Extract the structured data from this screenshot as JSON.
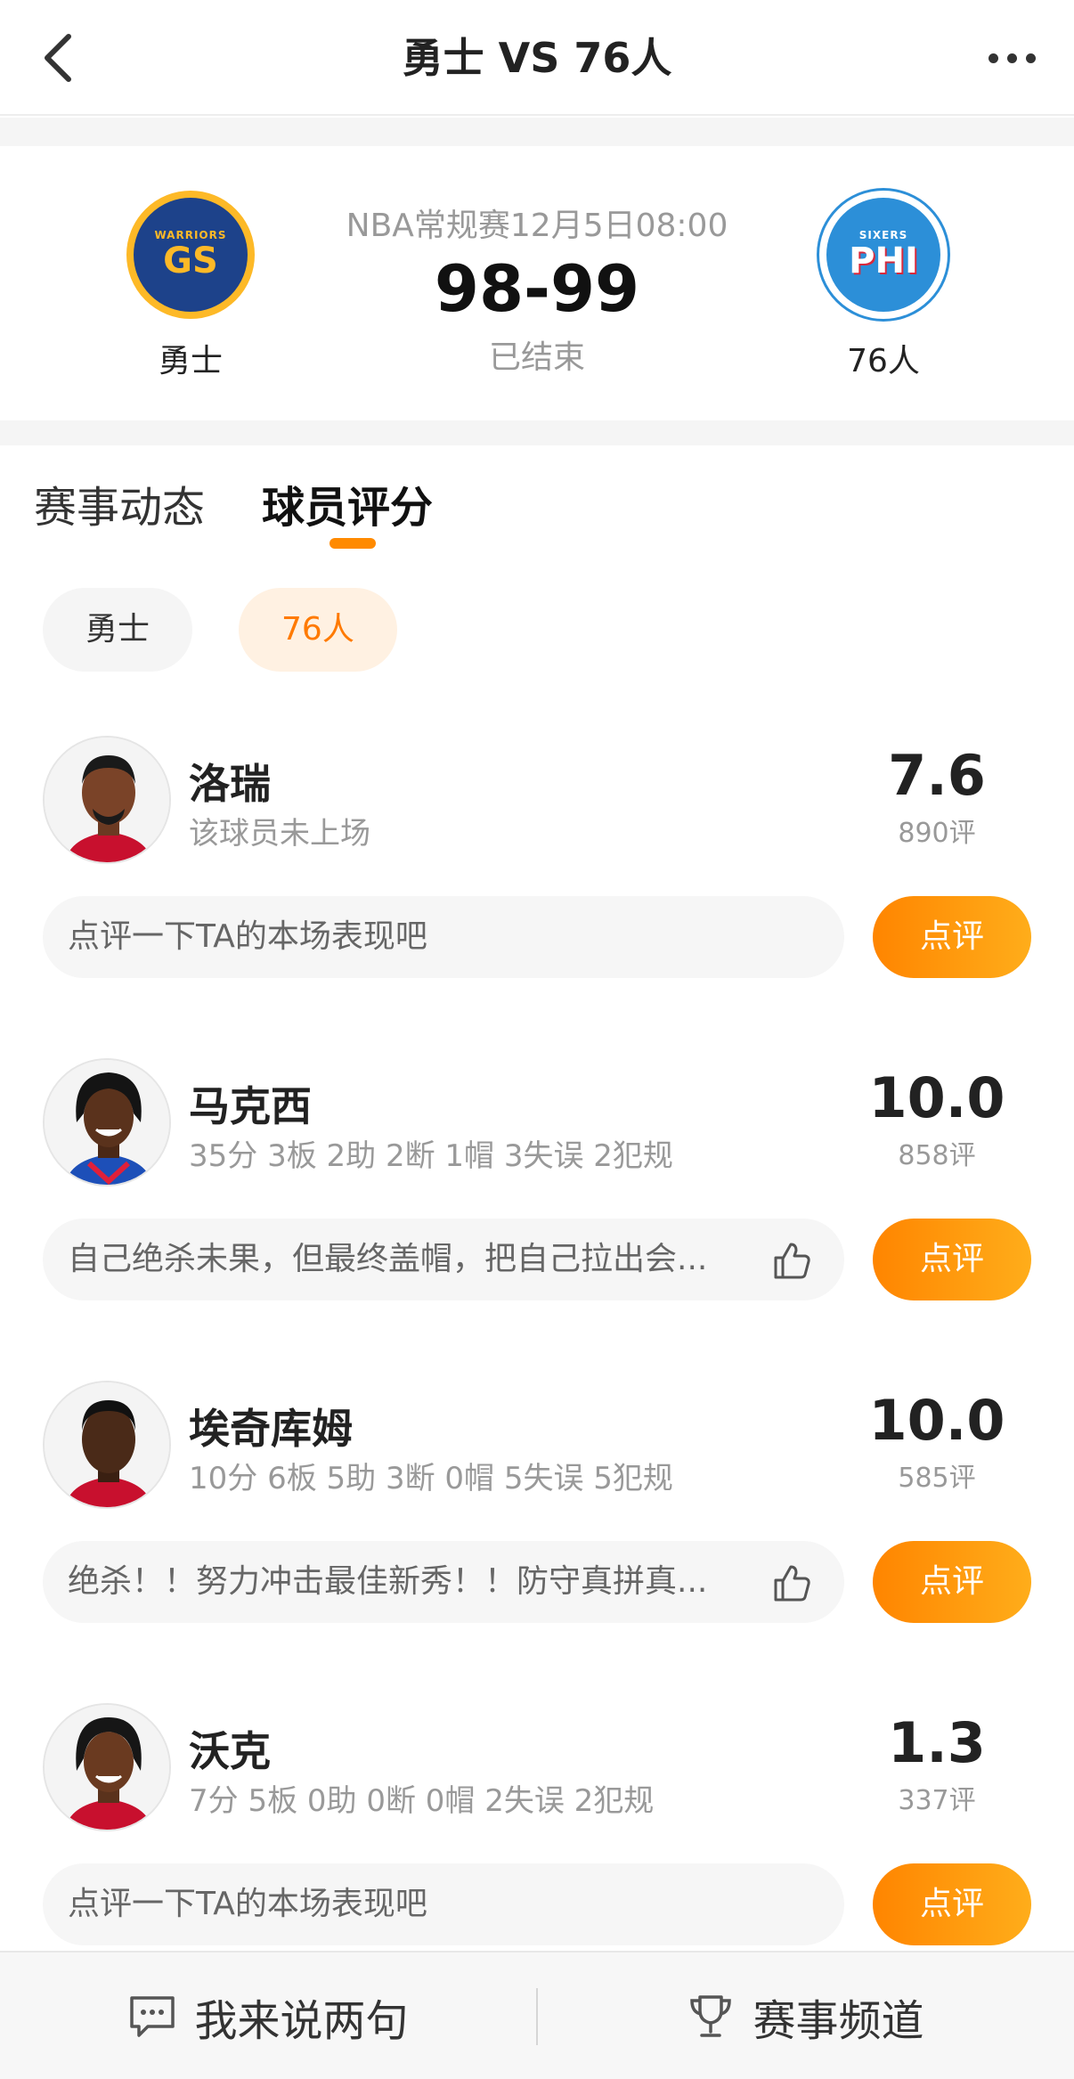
{
  "nav": {
    "title": "勇士 VS 76人"
  },
  "match": {
    "info": "NBA常规赛12月5日08:00",
    "score": "98-99",
    "status": "已结束",
    "home": {
      "name": "勇士",
      "logo_top": "WARRIORS",
      "logo_main": "GS"
    },
    "away": {
      "name": "76人",
      "logo_top": "SIXERS",
      "logo_main": "PHI"
    }
  },
  "tabs": [
    {
      "label": "赛事动态"
    },
    {
      "label": "球员评分"
    }
  ],
  "team_switch": [
    {
      "label": "勇士"
    },
    {
      "label": "76人"
    }
  ],
  "players": [
    {
      "name": "洛瑞",
      "stats": "该球员未上场",
      "rating": "7.6",
      "count": "890评",
      "comment": "点评一下TA的本场表现吧",
      "review": "点评"
    },
    {
      "name": "马克西",
      "stats": "35分 3板 2助 2断 1帽 3失误 2犯规",
      "rating": "10.0",
      "count": "858评",
      "comment": "自己绝杀未果，但最终盖帽，把自己拉出会...",
      "review": "点评"
    },
    {
      "name": "埃奇库姆",
      "stats": "10分 6板 5助 3断 0帽 5失误 5犯规",
      "rating": "10.0",
      "count": "585评",
      "comment": "绝杀！！努力冲击最佳新秀！！防守真拼真...",
      "review": "点评"
    },
    {
      "name": "沃克",
      "stats": "7分 5板 0助 0断 0帽 2失误 2犯规",
      "rating": "1.3",
      "count": "337评",
      "comment": "点评一下TA的本场表现吧",
      "review": "点评"
    }
  ],
  "bottom_bar": {
    "left": "我来说两句",
    "right": "赛事频道"
  },
  "colors": {
    "accent": "#ff8a00",
    "pill_active_bg": "#fff1e2"
  }
}
